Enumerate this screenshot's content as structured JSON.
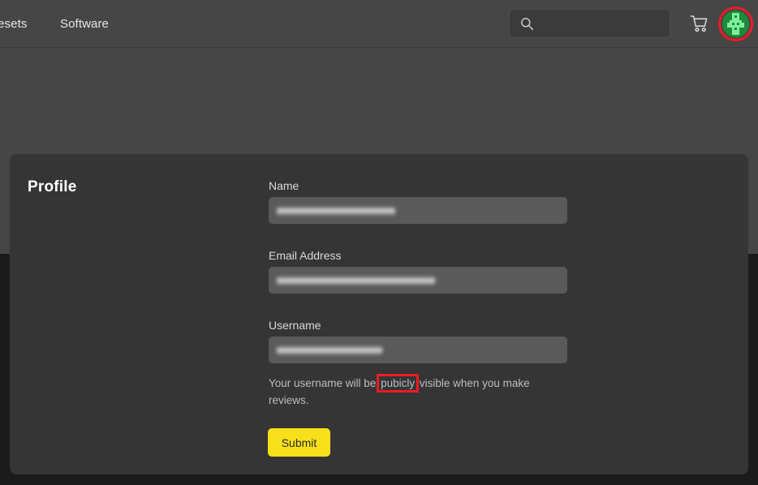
{
  "header": {
    "nav": [
      {
        "label": "resets",
        "name": "nav-presets"
      },
      {
        "label": "Software",
        "name": "nav-software"
      }
    ],
    "search": {
      "value": "",
      "placeholder": "",
      "icon": "search-icon"
    },
    "cart_icon": "shopping-cart-icon",
    "avatar": {
      "icon": "user-avatar-icon",
      "background_color": "#1f8b3a",
      "highlight_ring_color": "#ec1c24"
    }
  },
  "card": {
    "title": "Profile",
    "fields": [
      {
        "label": "Name",
        "value": "",
        "redacted": true
      },
      {
        "label": "Email Address",
        "value": "",
        "redacted": true
      },
      {
        "label": "Username",
        "value": "",
        "redacted": true
      }
    ],
    "helper": {
      "before": "Your username will be ",
      "highlighted": "pubicly",
      "after": " visible when you make reviews.",
      "highlight_color": "#ec1c24"
    },
    "submit_label": "Submit",
    "submit_color": "#f7e019"
  },
  "theme": {
    "topbar_bg": "#464646",
    "page_upper_bg": "#464646",
    "page_lower_bg": "#1b1b1b",
    "card_bg": "#353535",
    "input_bg": "#5a5a5a"
  }
}
